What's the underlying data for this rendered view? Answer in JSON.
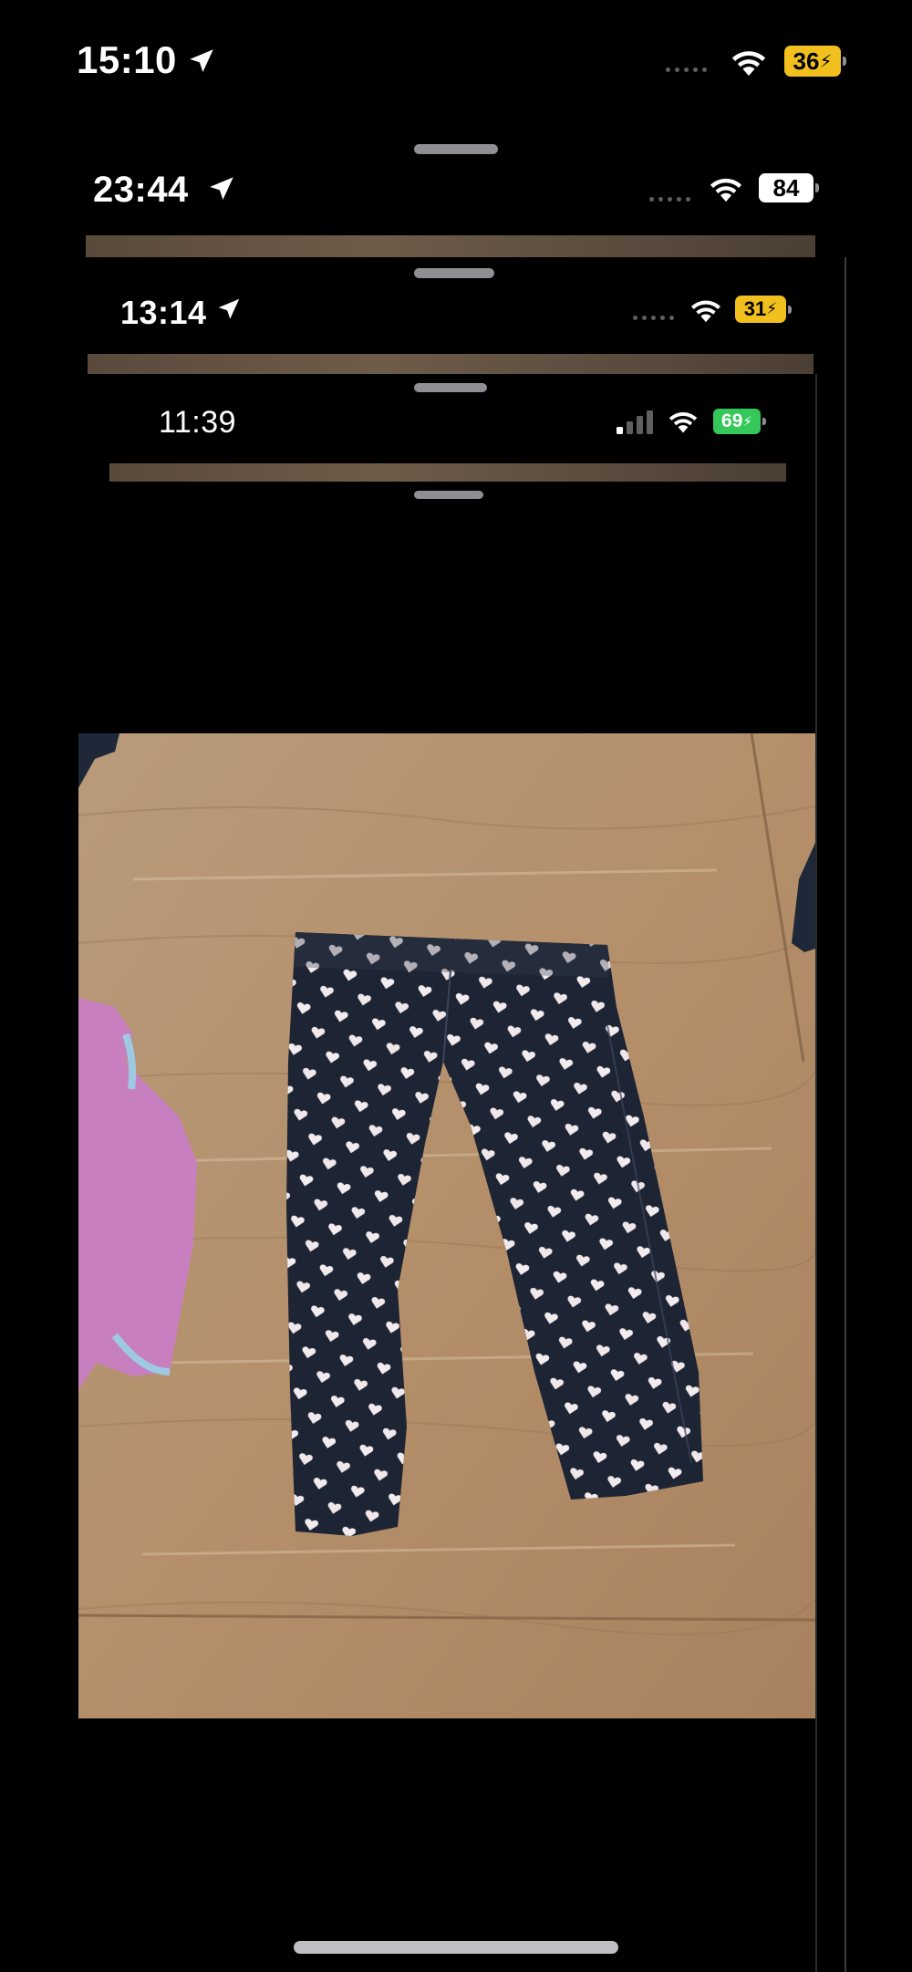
{
  "screens": [
    {
      "time": "15:10",
      "battery": "36",
      "battery_color": "#f2c01e",
      "battery_text_color": "#000000",
      "charging": true,
      "location_arrow": true
    },
    {
      "time": "23:44",
      "battery": "84",
      "battery_color": "#ffffff",
      "battery_text_color": "#000000",
      "charging": false,
      "location_arrow": true
    },
    {
      "time": "13:14",
      "battery": "31",
      "battery_color": "#f2c01e",
      "battery_text_color": "#000000",
      "charging": true,
      "location_arrow": true
    },
    {
      "time": "11:39",
      "battery": "69",
      "battery_color": "#34c759",
      "battery_text_color": "#ffffff",
      "charging": true,
      "location_arrow": false
    }
  ],
  "icons": {
    "location": "location-arrow-icon",
    "wifi": "wifi-icon",
    "signal": "cellular-signal-icon",
    "battery": "battery-icon",
    "charging": "lightning-bolt-icon"
  },
  "photo": {
    "subject": "dark denim baby leggings with white heart print",
    "background": "light oak wooden table",
    "colors": {
      "table": "#b79572",
      "leggings": "#1d2433",
      "hearts": "#f2ecef",
      "pink_garment": "#c87fbf"
    }
  }
}
